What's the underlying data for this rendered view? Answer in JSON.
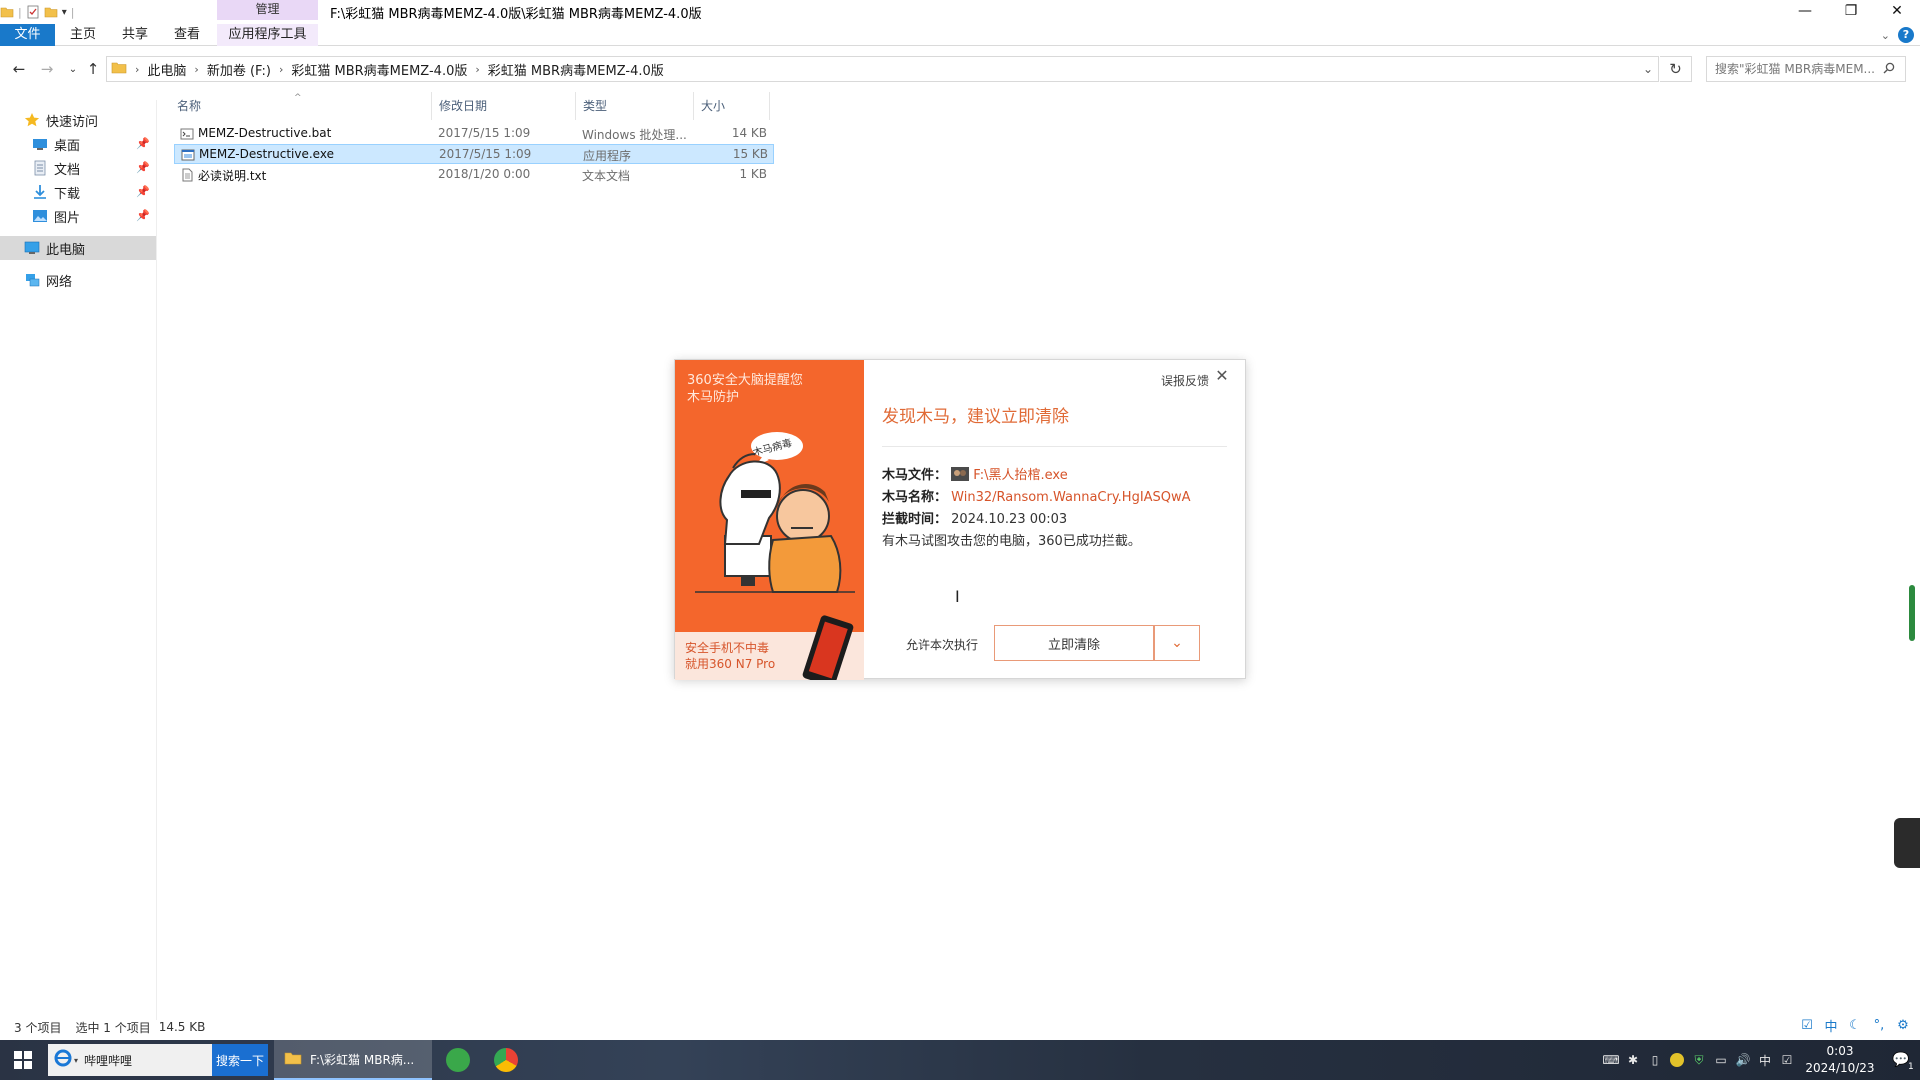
{
  "window": {
    "title": "F:\\彩虹猫 MBR病毒MEMZ-4.0版\\彩虹猫 MBR病毒MEMZ-4.0版",
    "manage_tab": "管理",
    "minimize": "—",
    "restore": "❐",
    "close": "✕"
  },
  "ribbon": {
    "tabs": [
      "文件",
      "主页",
      "共享",
      "查看",
      "应用程序工具"
    ],
    "help": "?"
  },
  "address": {
    "crumbs": [
      "此电脑",
      "新加卷 (F:)",
      "彩虹猫 MBR病毒MEMZ-4.0版",
      "彩虹猫 MBR病毒MEMZ-4.0版"
    ],
    "search_placeholder": "搜索\"彩虹猫 MBR病毒MEM..."
  },
  "navpane": {
    "quick_access": "快速访问",
    "items": [
      "桌面",
      "文档",
      "下载",
      "图片"
    ],
    "this_pc": "此电脑",
    "network": "网络"
  },
  "filelist": {
    "columns": [
      "名称",
      "修改日期",
      "类型",
      "大小"
    ],
    "rows": [
      {
        "name": "MEMZ-Destructive.bat",
        "date": "2017/5/15 1:09",
        "type": "Windows 批处理...",
        "size": "14 KB"
      },
      {
        "name": "MEMZ-Destructive.exe",
        "date": "2017/5/15 1:09",
        "type": "应用程序",
        "size": "15 KB"
      },
      {
        "name": "必读说明.txt",
        "date": "2018/1/20 0:00",
        "type": "文本文档",
        "size": "1 KB"
      }
    ]
  },
  "status": {
    "count": "3 个项目",
    "selected": "选中 1 个项目",
    "size": "14.5 KB"
  },
  "popup": {
    "left_title_1": "360安全大脑提醒您",
    "left_title_2": "木马防护",
    "bubble": "木马病毒",
    "ad_line1": "安全手机不中毒",
    "ad_line2": "就用360 N7 Pro",
    "feedback": "误报反馈",
    "heading": "发现木马，建议立即清除",
    "file_label": "木马文件：",
    "file_value": "F:\\黑人抬棺.exe",
    "name_label": "木马名称：",
    "name_value": "Win32/Ransom.WannaCry.HgIASQwA",
    "time_label": "拦截时间：",
    "time_value": "2024.10.23 00:03",
    "message": "有木马试图攻击您的电脑，360已成功拦截。",
    "allow_once": "允许本次执行",
    "clean_now": "立即清除"
  },
  "taskbar": {
    "search_text": "哔哩哔哩",
    "search_btn": "搜索一下",
    "explorer_label": "F:\\彩虹猫 MBR病...",
    "ime": "中",
    "time": "0:03",
    "date": "2024/10/23",
    "notif_count": "1"
  },
  "view_toolbar": {
    "ime_label": "中"
  },
  "colors": {
    "accent": "#1979ca",
    "popup_orange": "#f4662c",
    "popup_red": "#d6542a",
    "selection": "#cce8ff"
  }
}
